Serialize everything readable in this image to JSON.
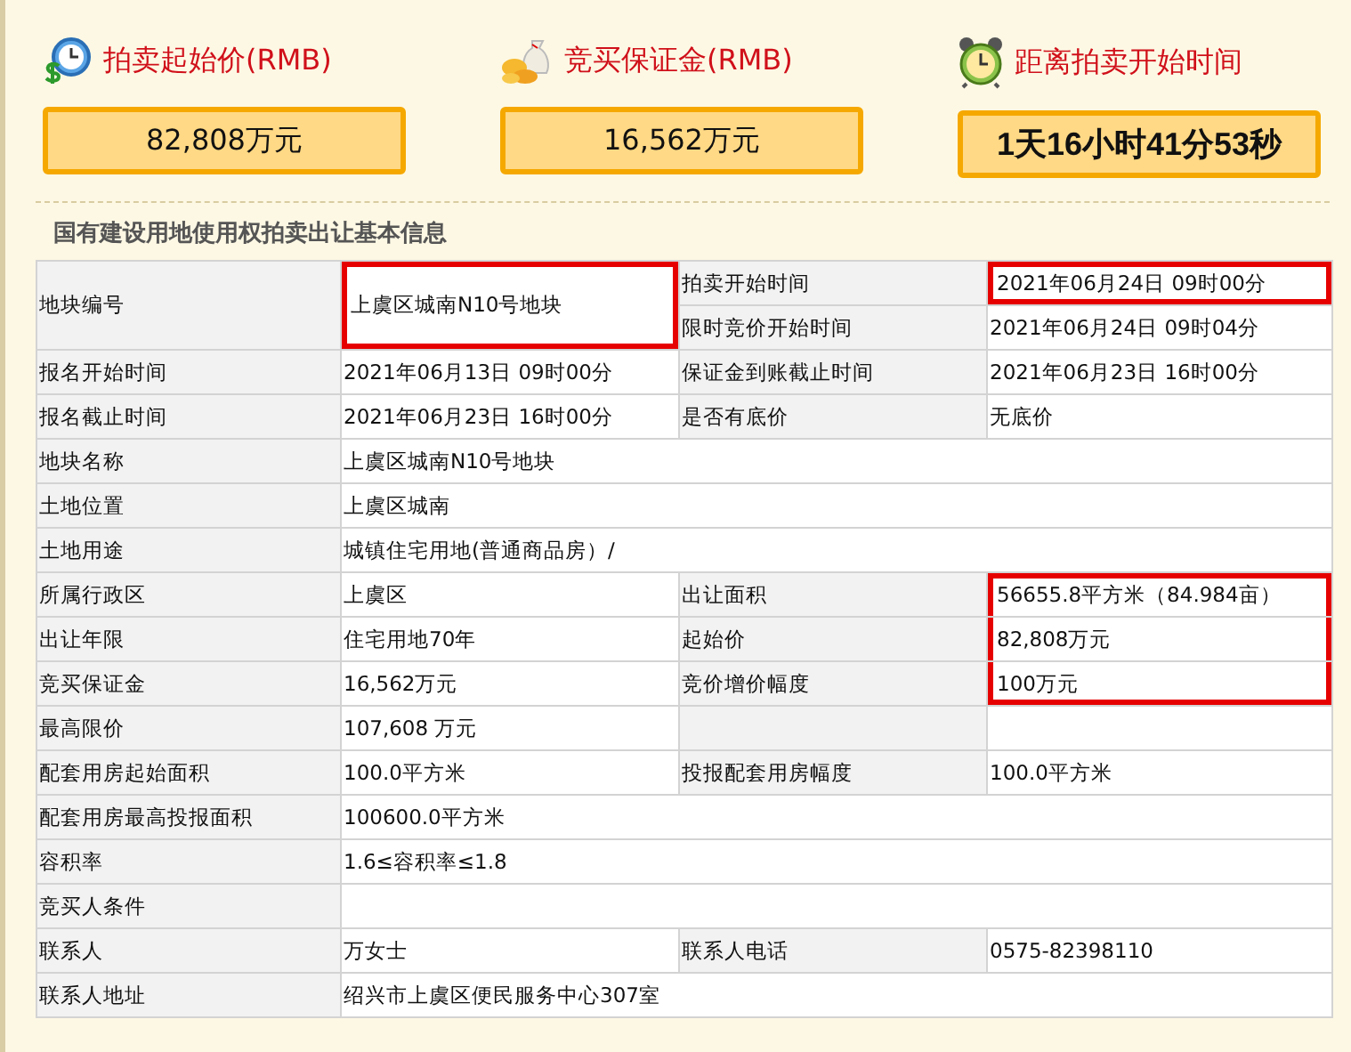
{
  "stats": [
    {
      "kind": "price",
      "title": "拍卖起始价(RMB)",
      "value": "82,808万元"
    },
    {
      "kind": "deposit",
      "title": "竞买保证金(RMB)",
      "value": "16,562万元"
    },
    {
      "kind": "countdown",
      "title": "距离拍卖开始时间",
      "value": "1天16小时41分53秒"
    }
  ],
  "section_title": "国有建设用地使用权拍卖出让基本信息",
  "rows": [
    {
      "kind": "merged",
      "pairs": [
        {
          "label": "地块编号",
          "value": "上虞区城南N10号地块",
          "highlighted": true
        },
        {
          "label": "拍卖开始时间",
          "value": "2021年06月24日 09时00分",
          "highlighted": true
        },
        {
          "label": "限时竞价开始时间",
          "value": "2021年06月24日 09时04分",
          "highlighted": false
        }
      ]
    },
    {
      "kind": "split",
      "pairs": [
        {
          "label": "报名开始时间",
          "value": "2021年06月13日 09时00分",
          "highlighted": false
        },
        {
          "label": "保证金到账截止时间",
          "value": "2021年06月23日 16时00分",
          "highlighted": false
        }
      ]
    },
    {
      "kind": "split",
      "pairs": [
        {
          "label": "报名截止时间",
          "value": "2021年06月23日 16时00分",
          "highlighted": false
        },
        {
          "label": "是否有底价",
          "value": "无底价",
          "highlighted": false
        }
      ]
    },
    {
      "kind": "full",
      "pairs": [
        {
          "label": "地块名称",
          "value": "上虞区城南N10号地块",
          "highlighted": false
        }
      ]
    },
    {
      "kind": "full",
      "pairs": [
        {
          "label": "土地位置",
          "value": "上虞区城南",
          "highlighted": false
        }
      ]
    },
    {
      "kind": "full",
      "pairs": [
        {
          "label": "土地用途",
          "value": "城镇住宅用地(普通商品房）/",
          "highlighted": false
        }
      ]
    },
    {
      "kind": "split",
      "pairs": [
        {
          "label": "所属行政区",
          "value": "上虞区",
          "highlighted": false
        },
        {
          "label": "出让面积",
          "value": "56655.8平方米（84.984亩）",
          "highlighted": true
        }
      ]
    },
    {
      "kind": "split",
      "pairs": [
        {
          "label": "出让年限",
          "value": "住宅用地70年",
          "highlighted": false
        },
        {
          "label": "起始价",
          "value": "82,808万元",
          "highlighted": true
        }
      ]
    },
    {
      "kind": "split",
      "pairs": [
        {
          "label": "竞买保证金",
          "value": "16,562万元",
          "highlighted": false
        },
        {
          "label": "竞价增价幅度",
          "value": "100万元",
          "highlighted": true
        }
      ]
    },
    {
      "kind": "split",
      "pairs": [
        {
          "label": "最高限价",
          "value": "107,608 万元",
          "highlighted": false
        },
        {
          "highlighted": false
        }
      ]
    },
    {
      "kind": "split",
      "pairs": [
        {
          "label": "配套用房起始面积",
          "value": "100.0平方米",
          "highlighted": false
        },
        {
          "label": "投报配套用房幅度",
          "value": "100.0平方米",
          "highlighted": false
        }
      ]
    },
    {
      "kind": "full",
      "pairs": [
        {
          "label": "配套用房最高投报面积",
          "value": "100600.0平方米",
          "highlighted": false
        }
      ]
    },
    {
      "kind": "full",
      "pairs": [
        {
          "label": "容积率",
          "value": "1.6≤容积率≤1.8",
          "highlighted": false
        }
      ]
    },
    {
      "kind": "full",
      "pairs": [
        {
          "label": "竞买人条件",
          "highlighted": false
        }
      ]
    },
    {
      "kind": "split",
      "pairs": [
        {
          "label": "联系人",
          "value": "万女士",
          "highlighted": false
        },
        {
          "label": "联系人电话",
          "value": "0575-82398110",
          "highlighted": false
        }
      ]
    },
    {
      "kind": "full",
      "pairs": [
        {
          "label": "联系人地址",
          "value": "绍兴市上虞区便民服务中心307室",
          "highlighted": false
        }
      ]
    }
  ]
}
